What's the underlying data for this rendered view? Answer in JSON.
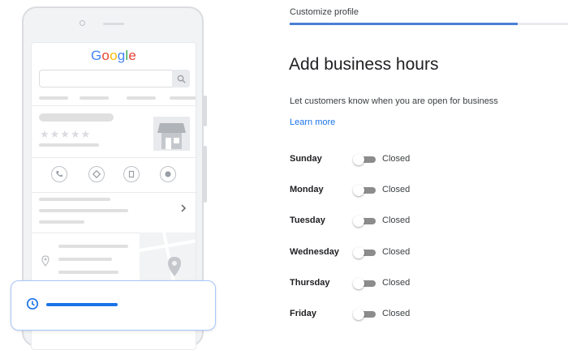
{
  "header": {
    "step_label": "Customize profile",
    "progress_fraction": 0.82
  },
  "main": {
    "title": "Add business hours",
    "subtitle": "Let customers know when you are open for business",
    "learn_more": "Learn more",
    "days": [
      {
        "name": "Sunday",
        "status": "Closed",
        "open": false
      },
      {
        "name": "Monday",
        "status": "Closed",
        "open": false
      },
      {
        "name": "Tuesday",
        "status": "Closed",
        "open": false
      },
      {
        "name": "Wednesday",
        "status": "Closed",
        "open": false
      },
      {
        "name": "Thursday",
        "status": "Closed",
        "open": false
      },
      {
        "name": "Friday",
        "status": "Closed",
        "open": false
      }
    ]
  },
  "illustration": {
    "logo_letters": [
      {
        "ch": "G",
        "color": "#4285F4"
      },
      {
        "ch": "o",
        "color": "#EA4335"
      },
      {
        "ch": "o",
        "color": "#FBBC05"
      },
      {
        "ch": "g",
        "color": "#4285F4"
      },
      {
        "ch": "l",
        "color": "#34A853"
      },
      {
        "ch": "e",
        "color": "#EA4335"
      }
    ],
    "icons": [
      "search-icon",
      "phone-icon",
      "directions-icon",
      "save-icon",
      "website-icon",
      "chevron-right-icon",
      "map-pin-icon",
      "clock-icon"
    ]
  },
  "colors": {
    "accent": "#1a73e8",
    "progress": "#4a7fd6",
    "toggle_off": "#8c8c8c"
  }
}
